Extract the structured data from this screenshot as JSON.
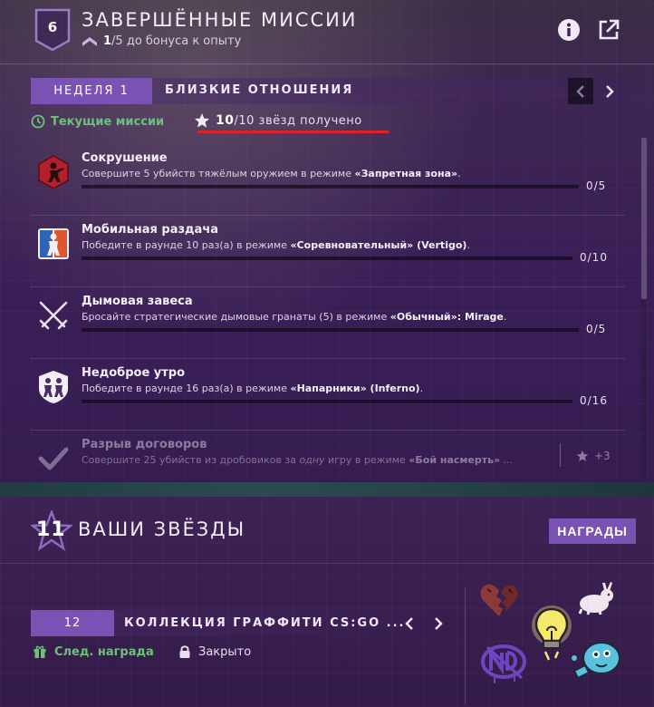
{
  "header": {
    "level": "6",
    "title": "ЗАВЕРШЁННЫЕ МИССИИ",
    "bonus_current": "1",
    "bonus_rest": "/5 до бонуса к опыту"
  },
  "week": {
    "tab": "НЕДЕЛЯ 1",
    "name": "БЛИЗКИЕ ОТНОШЕНИЯ"
  },
  "status": {
    "current_label": "Текущие миссии",
    "stars_bold": "10",
    "stars_rest": "/10 звёзд получено"
  },
  "missions": [
    {
      "title": "Сокрушение",
      "desc_pre": "Совершите 5 убийств тяжёлым оружием в режиме ",
      "desc_bold": "«Запретная зона»",
      "desc_post": ".",
      "progress": "0/5",
      "icon": "danger-zone-icon"
    },
    {
      "title": "Мобильная раздача",
      "desc_pre": "Победите в раунде 10 раз(а) в режиме ",
      "desc_bold": "«Соревновательный» (Vertigo)",
      "desc_post": ".",
      "progress": "0/10",
      "icon": "competitive-icon"
    },
    {
      "title": "Дымовая завеса",
      "desc_pre": "Бросайте стратегические дымовые гранаты (5) в режиме ",
      "desc_bold": "«Обычный»: Mirage",
      "desc_post": ".",
      "progress": "0/5",
      "icon": "crossed-swords-icon"
    },
    {
      "title": "Недоброе утро",
      "desc_pre": "Победите в раунде 16 раз(а) в режиме ",
      "desc_bold": "«Напарники» (Inferno)",
      "desc_post": ".",
      "progress": "0/16",
      "icon": "wingman-icon"
    },
    {
      "title": "Разрыв договоров",
      "desc_pre": "Совершите 25 убийств из дробовиков за ",
      "desc_italic": "одну",
      "desc_mid": " игру в режиме ",
      "desc_bold": "«Бой насмерть»",
      "desc_post": " ...",
      "reward": "+3",
      "icon": "checkmark-icon"
    }
  ],
  "stars": {
    "count": "11",
    "title": "ВАШИ ЗВЁЗДЫ",
    "rewards_button": "НАГРАДЫ"
  },
  "collection": {
    "number": "12",
    "name": "КОЛЛЕКЦИЯ ГРАФФИТИ CS:GO ...",
    "next_reward": "След. награда",
    "locked": "Закрыто"
  },
  "colors": {
    "accent": "#7a52b4",
    "green": "#6cc17a",
    "underline": "#e0202a"
  }
}
